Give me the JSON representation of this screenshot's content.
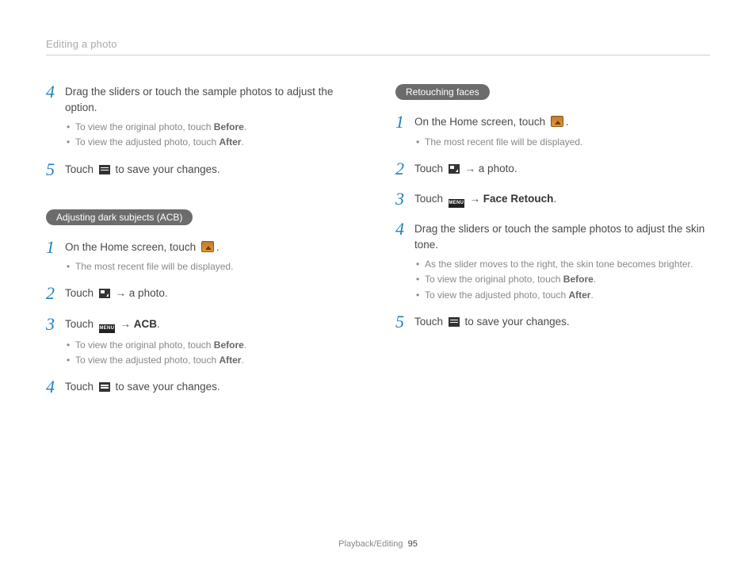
{
  "header": {
    "title": "Editing a photo"
  },
  "footer": {
    "section": "Playback/Editing",
    "page": "95"
  },
  "icons": {
    "menu_label": "MENU"
  },
  "left": {
    "top": {
      "s4": {
        "num": "4",
        "text": "Drag the sliders or touch the sample photos to adjust the option.",
        "sub1_a": "To view the original photo, touch ",
        "sub1_b": "Before",
        "sub1_c": ".",
        "sub2_a": "To view the adjusted photo, touch ",
        "sub2_b": "After",
        "sub2_c": "."
      },
      "s5": {
        "num": "5",
        "a": "Touch ",
        "b": " to save your changes."
      }
    },
    "pill": "Adjusting dark subjects (ACB)",
    "acb": {
      "s1": {
        "num": "1",
        "a": "On the Home screen, touch ",
        "b": ".",
        "sub1": "The most recent file will be displayed."
      },
      "s2": {
        "num": "2",
        "a": "Touch ",
        "arrow": " → ",
        "b": "a photo."
      },
      "s3": {
        "num": "3",
        "a": "Touch ",
        "arrow": " → ",
        "b": "ACB",
        "c": ".",
        "sub1_a": "To view the original photo, touch ",
        "sub1_b": "Before",
        "sub1_c": ".",
        "sub2_a": "To view the adjusted photo, touch ",
        "sub2_b": "After",
        "sub2_c": "."
      },
      "s4": {
        "num": "4",
        "a": "Touch ",
        "b": " to save your changes."
      }
    }
  },
  "right": {
    "pill": "Retouching faces",
    "fr": {
      "s1": {
        "num": "1",
        "a": "On the Home screen, touch ",
        "b": ".",
        "sub1": "The most recent file will be displayed."
      },
      "s2": {
        "num": "2",
        "a": "Touch ",
        "arrow": " → ",
        "b": "a photo."
      },
      "s3": {
        "num": "3",
        "a": "Touch ",
        "arrow": " → ",
        "b": "Face Retouch",
        "c": "."
      },
      "s4": {
        "num": "4",
        "text": "Drag the sliders or touch the sample photos to adjust the skin tone.",
        "sub1": "As the slider moves to the right, the skin tone becomes brighter.",
        "sub2_a": "To view the original photo, touch ",
        "sub2_b": "Before",
        "sub2_c": ".",
        "sub3_a": "To view the adjusted photo, touch ",
        "sub3_b": "After",
        "sub3_c": "."
      },
      "s5": {
        "num": "5",
        "a": "Touch ",
        "b": " to save your changes."
      }
    }
  }
}
